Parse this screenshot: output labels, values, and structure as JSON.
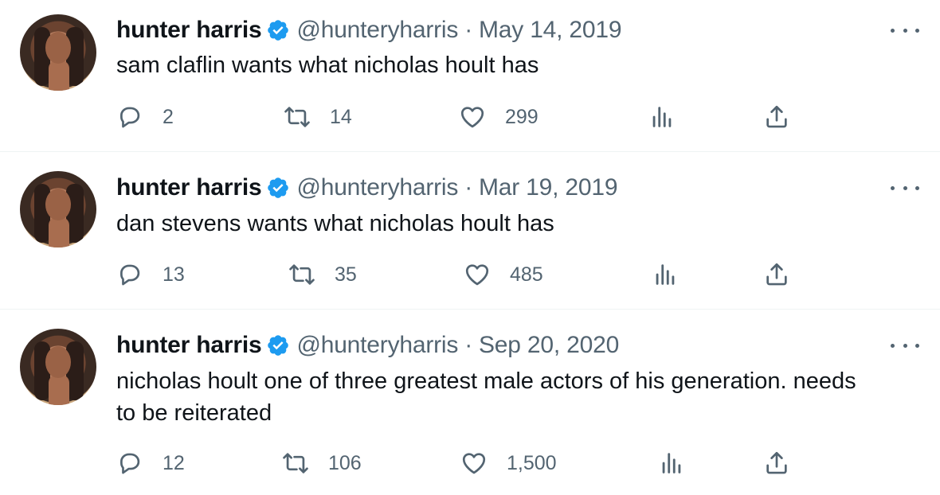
{
  "tweets": [
    {
      "name": "hunter harris",
      "handle": "@hunteryharris",
      "separator": "·",
      "date": "May 14, 2019",
      "text_lines": [
        "sam claflin wants what nicholas hoult has"
      ],
      "replies": "2",
      "retweets": "14",
      "likes": "299"
    },
    {
      "name": "hunter harris",
      "handle": "@hunteryharris",
      "separator": "·",
      "date": "Mar 19, 2019",
      "text_lines": [
        "dan stevens wants what nicholas hoult has"
      ],
      "replies": "13",
      "retweets": "35",
      "likes": "485"
    },
    {
      "name": "hunter harris",
      "handle": "@hunteryharris",
      "separator": "·",
      "date": "Sep 20, 2020",
      "text_lines": [
        "nicholas hoult one of three greatest male actors of his generation. needs",
        "to be reiterated"
      ],
      "replies": "12",
      "retweets": "106",
      "likes": "1,500"
    }
  ],
  "icons": {
    "verified": "verified-badge-icon",
    "more": "more-icon",
    "reply": "reply-icon",
    "retweet": "retweet-icon",
    "like": "heart-icon",
    "views": "views-icon",
    "share": "share-icon"
  },
  "colors": {
    "verified_blue": "#1d9bf0",
    "text": "#0f1419",
    "secondary_text": "#536471",
    "divider": "#eff3f4"
  }
}
